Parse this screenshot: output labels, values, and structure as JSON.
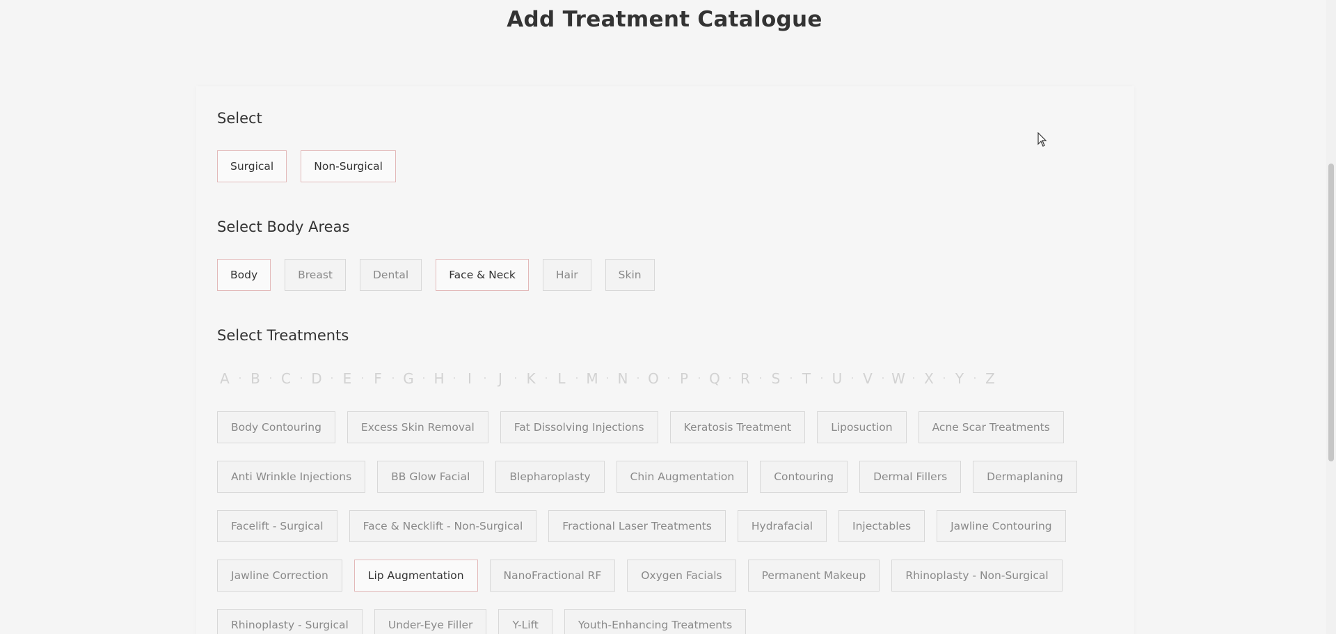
{
  "page": {
    "title": "Add Treatment Catalogue"
  },
  "select_section": {
    "heading": "Select",
    "options": [
      {
        "label": "Surgical",
        "active": true
      },
      {
        "label": "Non-Surgical",
        "active": true
      }
    ]
  },
  "body_areas_section": {
    "heading": "Select Body Areas",
    "options": [
      {
        "label": "Body",
        "active": true
      },
      {
        "label": "Breast",
        "active": false
      },
      {
        "label": "Dental",
        "active": false
      },
      {
        "label": "Face & Neck",
        "active": true
      },
      {
        "label": "Hair",
        "active": false
      },
      {
        "label": "Skin",
        "active": false
      }
    ]
  },
  "treatments_section": {
    "heading": "Select Treatments",
    "alphabet": [
      "A",
      "B",
      "C",
      "D",
      "E",
      "F",
      "G",
      "H",
      "I",
      "J",
      "K",
      "L",
      "M",
      "N",
      "O",
      "P",
      "Q",
      "R",
      "S",
      "T",
      "U",
      "V",
      "W",
      "X",
      "Y",
      "Z"
    ],
    "rows": [
      [
        {
          "label": "Body Contouring",
          "active": false
        },
        {
          "label": "Excess Skin Removal",
          "active": false
        },
        {
          "label": "Fat Dissolving Injections",
          "active": false
        },
        {
          "label": "Keratosis Treatment",
          "active": false
        },
        {
          "label": "Liposuction",
          "active": false
        },
        {
          "label": "Acne Scar Treatments",
          "active": false
        }
      ],
      [
        {
          "label": "Anti Wrinkle Injections",
          "active": false
        },
        {
          "label": "BB Glow Facial",
          "active": false
        },
        {
          "label": "Blepharoplasty",
          "active": false
        },
        {
          "label": "Chin Augmentation",
          "active": false
        },
        {
          "label": "Contouring",
          "active": false
        },
        {
          "label": "Dermal Fillers",
          "active": false
        },
        {
          "label": "Dermaplaning",
          "active": false
        }
      ],
      [
        {
          "label": "Facelift - Surgical",
          "active": false
        },
        {
          "label": "Face & Necklift - Non-Surgical",
          "active": false
        },
        {
          "label": "Fractional Laser Treatments",
          "active": false
        },
        {
          "label": "Hydrafacial",
          "active": false
        },
        {
          "label": "Injectables",
          "active": false
        },
        {
          "label": "Jawline Contouring",
          "active": false
        }
      ],
      [
        {
          "label": "Jawline Correction",
          "active": false
        },
        {
          "label": "Lip Augmentation",
          "active": true
        },
        {
          "label": "NanoFractional RF",
          "active": false
        },
        {
          "label": "Oxygen Facials",
          "active": false
        },
        {
          "label": "Permanent Makeup",
          "active": false
        },
        {
          "label": "Rhinoplasty - Non-Surgical",
          "active": false
        }
      ],
      [
        {
          "label": "Rhinoplasty - Surgical",
          "active": false
        },
        {
          "label": "Under-Eye Filler",
          "active": false
        },
        {
          "label": "Y-Lift",
          "active": false
        },
        {
          "label": "Youth-Enhancing Treatments",
          "active": false
        }
      ]
    ]
  },
  "colors": {
    "active_border": "#e3b9b9",
    "inactive_border": "#d8d8d8",
    "text_dark": "#333333",
    "text_muted": "#8a8a8a",
    "alphabet": "#d2d2d2"
  }
}
